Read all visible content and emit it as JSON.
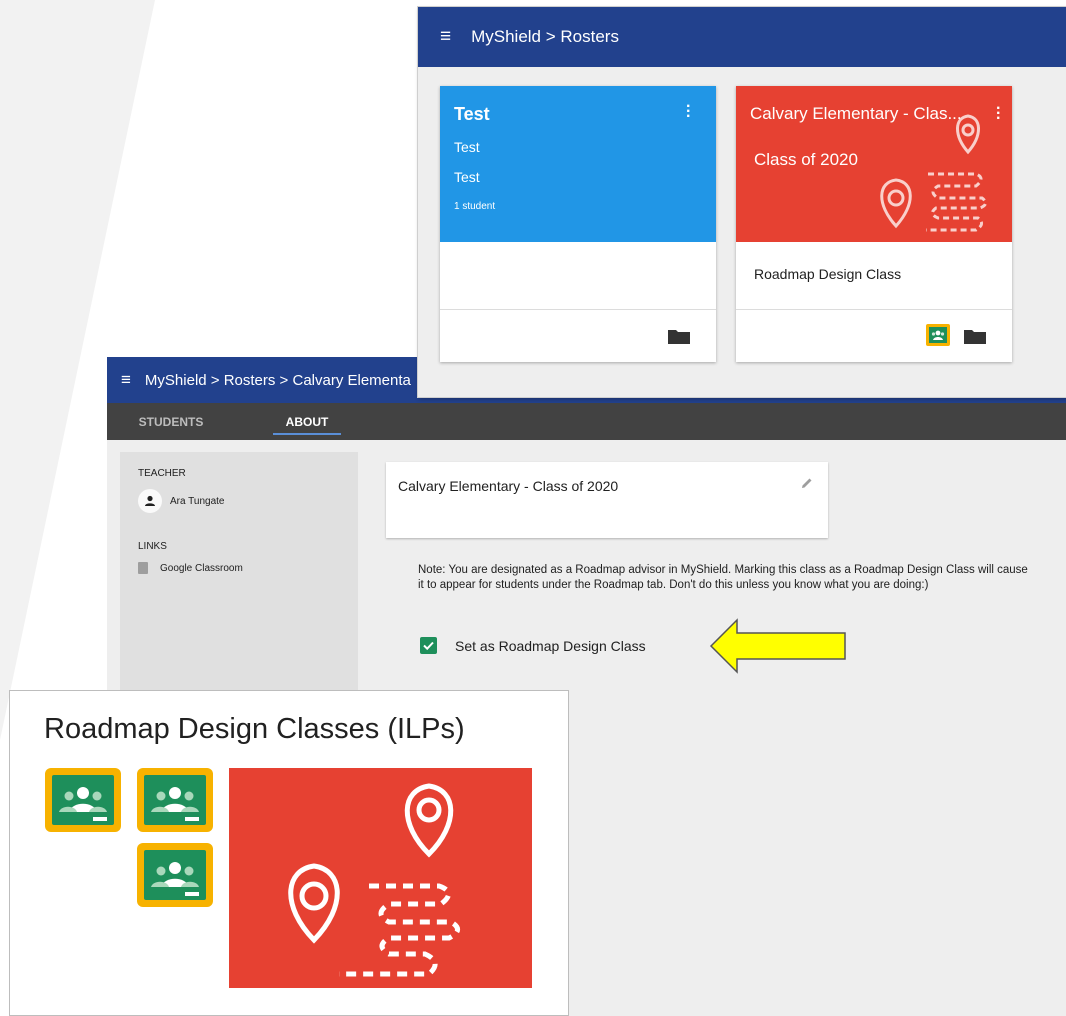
{
  "colors": {
    "app_bar": "#22418d",
    "tabs_bar": "#424242",
    "test_card": "#2196e6",
    "roadmap_red": "#e64132",
    "check_green": "#1e8f5b",
    "arrow_yellow": "#ffff00"
  },
  "rosters_window": {
    "breadcrumb": "MyShield > Rosters",
    "cards": [
      {
        "title": "Test",
        "line1": "Test",
        "line2": "Test",
        "count": "1 student",
        "body": ""
      },
      {
        "title": "Calvary Elementary - Clas...",
        "subtitle": "Class of 2020",
        "body": "Roadmap Design Class"
      }
    ]
  },
  "about_window": {
    "breadcrumb": "MyShield > Rosters > Calvary Elementa",
    "tabs": [
      "STUDENTS",
      "ABOUT"
    ],
    "active_tab": "ABOUT",
    "sidebar": {
      "teacher_heading": "TEACHER",
      "teacher_name": "Ara Tungate",
      "links_heading": "LINKS",
      "link_label": "Google Classroom"
    },
    "class_name": "Calvary Elementary - Class of 2020",
    "note": "Note: You are designated as a Roadmap advisor in MyShield.  Marking this class as a Roadmap Design Class will cause it to appear for students under the Roadmap tab.  Don't do this unless you know what you are doing:)",
    "checkbox_label": "Set as Roadmap Design Class",
    "checkbox_checked": true
  },
  "rdc_panel": {
    "title": "Roadmap Design Classes (ILPs)"
  }
}
